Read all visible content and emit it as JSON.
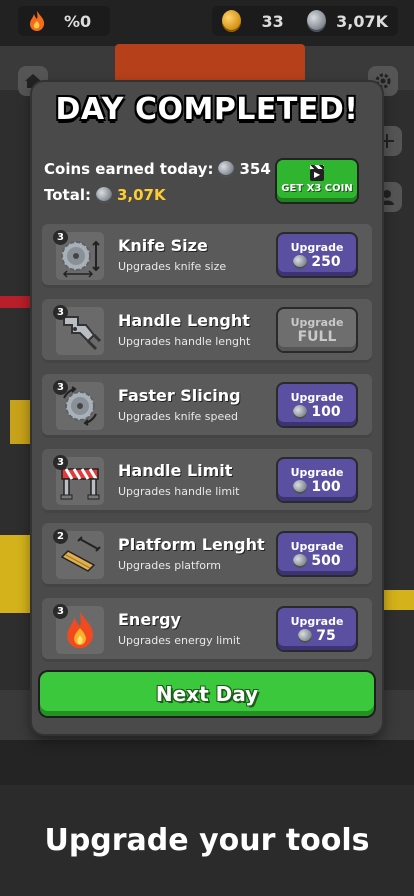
{
  "hud": {
    "energy_value": "%0",
    "gold_coins": "33",
    "silver_coins": "3,07K"
  },
  "modal": {
    "title": "DAY COMPLETED!",
    "earned_label": "Coins earned today:",
    "earned_value": "354",
    "total_label": "Total:",
    "total_value": "3,07K",
    "x3_button_label": "GET X3 COIN",
    "upgrade_label": "Upgrade",
    "next_day_label": "Next Day"
  },
  "upgrades": [
    {
      "level": "3",
      "name": "Knife Size",
      "desc": "Upgrades knife size",
      "cost": "250",
      "icon": "saw-blade-resize-icon"
    },
    {
      "level": "3",
      "name": "Handle Lenght",
      "desc": "Upgrades handle lenght",
      "cost": "FULL",
      "icon": "robot-arm-icon"
    },
    {
      "level": "3",
      "name": "Faster Slicing",
      "desc": "Upgrades knife speed",
      "cost": "100",
      "icon": "saw-blade-spin-icon"
    },
    {
      "level": "3",
      "name": "Handle Limit",
      "desc": "Upgrades handle limit",
      "cost": "100",
      "icon": "barrier-icon"
    },
    {
      "level": "2",
      "name": "Platform Lenght",
      "desc": "Upgrades platform",
      "cost": "500",
      "icon": "platform-plank-icon"
    },
    {
      "level": "3",
      "name": "Energy",
      "desc": "Upgrades energy limit",
      "cost": "75",
      "icon": "flame-icon"
    }
  ],
  "footer": {
    "caption": "Upgrade your tools"
  },
  "colors": {
    "upgrade_button": "#5a4fa0",
    "next_day_button": "#3cc83c",
    "x3_button": "#2fb52f",
    "gold_text": "#ffcc33"
  }
}
